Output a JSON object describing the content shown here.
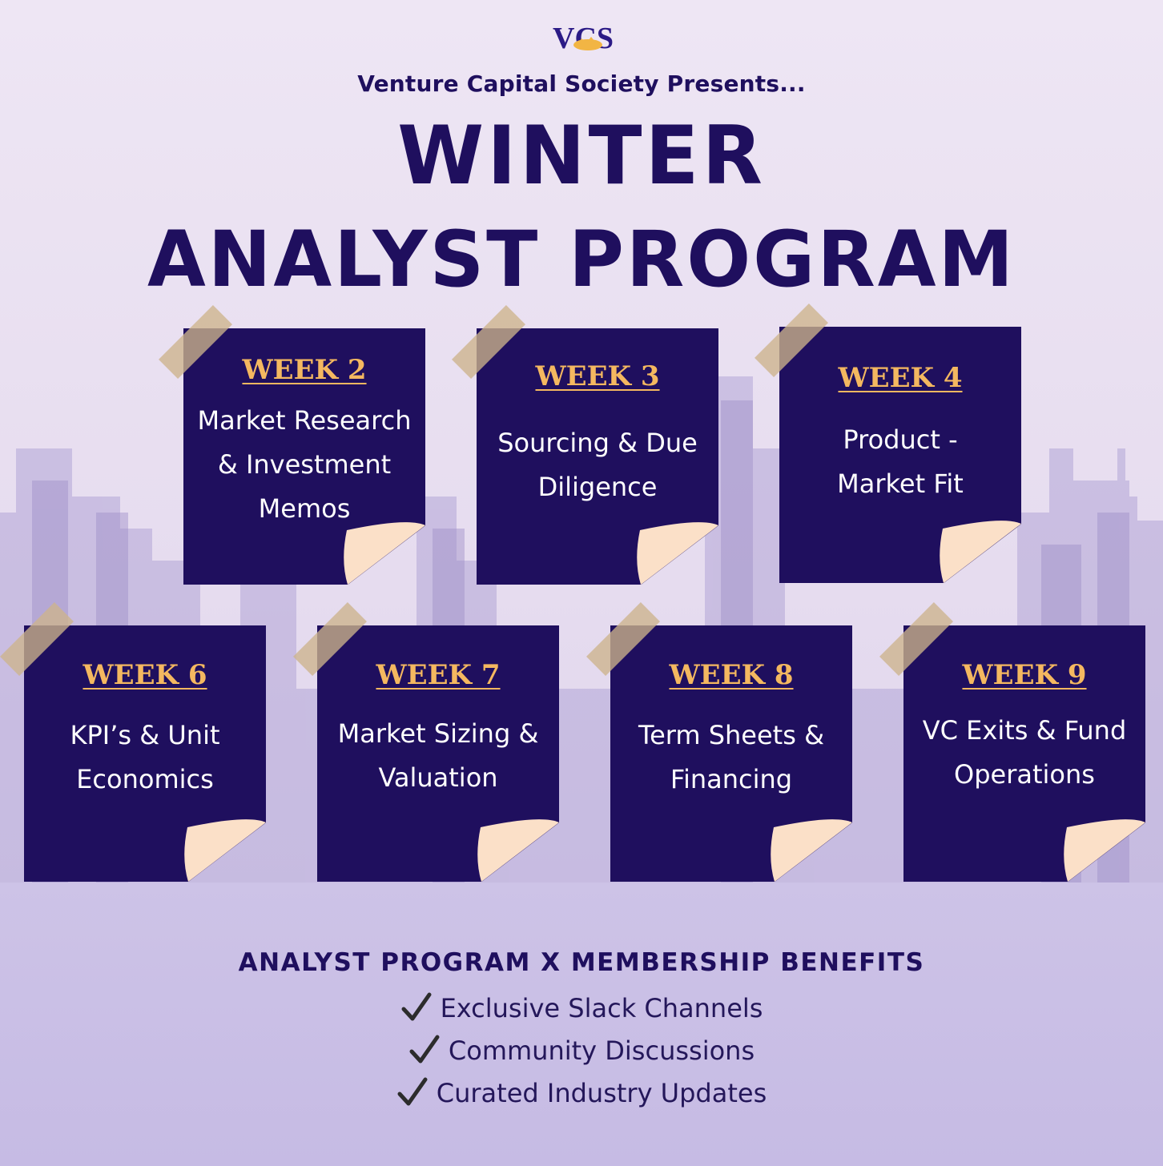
{
  "header": {
    "logo_text": "VCS",
    "presents": "Venture Capital Society Presents...",
    "title_line1": "WINTER",
    "title_line2": "ANALYST PROGRAM"
  },
  "weeks": [
    {
      "label": "WEEK 2",
      "topic": "Market Research\n& Investment\nMemos"
    },
    {
      "label": "WEEK 3",
      "topic": "Sourcing & Due\nDiligence"
    },
    {
      "label": "WEEK 4",
      "topic": "Product -\nMarket Fit"
    },
    {
      "label": "WEEK 6",
      "topic": "KPI’s & Unit\nEconomics"
    },
    {
      "label": "WEEK 7",
      "topic": "Market Sizing &\nValuation"
    },
    {
      "label": "WEEK 8",
      "topic": "Term Sheets &\nFinancing"
    },
    {
      "label": "WEEK 9",
      "topic": "VC Exits & Fund\nOperations"
    }
  ],
  "benefits": {
    "title": "ANALYST PROGRAM X MEMBERSHIP BENEFITS",
    "items": [
      "Exclusive Slack Channels",
      "Community Discussions",
      "Curated Industry Updates"
    ]
  },
  "colors": {
    "navy": "#1f0f5e",
    "gold": "#f4b860",
    "skyline": "#a99bd0",
    "curl": "#fbe0c8"
  },
  "icons": {
    "benefit_marker": "checkmark-icon",
    "skyline": "city-skyline-graphic"
  }
}
